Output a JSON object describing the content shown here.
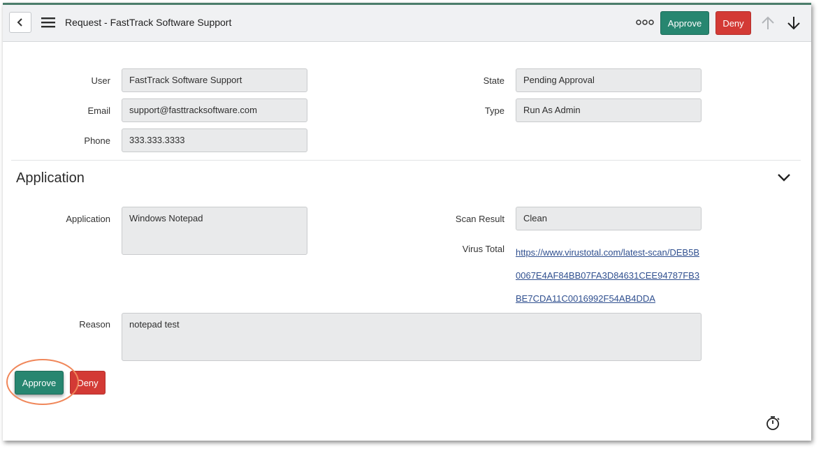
{
  "header": {
    "title": "Request - FastTrack Software Support",
    "approve_label": "Approve",
    "deny_label": "Deny",
    "icons": {
      "back": "chevron-left-icon",
      "menu": "hamburger-menu-icon",
      "more": "more-options-icon",
      "up": "arrow-up-icon",
      "down": "arrow-down-icon"
    }
  },
  "requester": {
    "user_label": "User",
    "user_value": "FastTrack Software Support",
    "email_label": "Email",
    "email_value": "support@fasttracksoftware.com",
    "phone_label": "Phone",
    "phone_value": "333.333.3333",
    "state_label": "State",
    "state_value": "Pending Approval",
    "type_label": "Type",
    "type_value": "Run As Admin"
  },
  "application_section": {
    "title": "Application",
    "application_label": "Application",
    "application_value": "Windows Notepad",
    "scan_label": "Scan Result",
    "scan_value": "Clean",
    "virus_label": "Virus Total",
    "virus_link": "https://www.virustotal.com/latest-scan/DEB5B0067E4AF84BB07FA3D84631CEE94787FB3BE7CDA11C0016992F54AB4DDA",
    "reason_label": "Reason",
    "reason_value": "notepad test"
  },
  "footer": {
    "approve_label": "Approve",
    "deny_label": "Deny"
  },
  "colors": {
    "approve": "#278670",
    "deny": "#d33a35",
    "accent_border": "#4b7d6b",
    "highlight": "#f0875a",
    "link": "#2f4f8f"
  }
}
